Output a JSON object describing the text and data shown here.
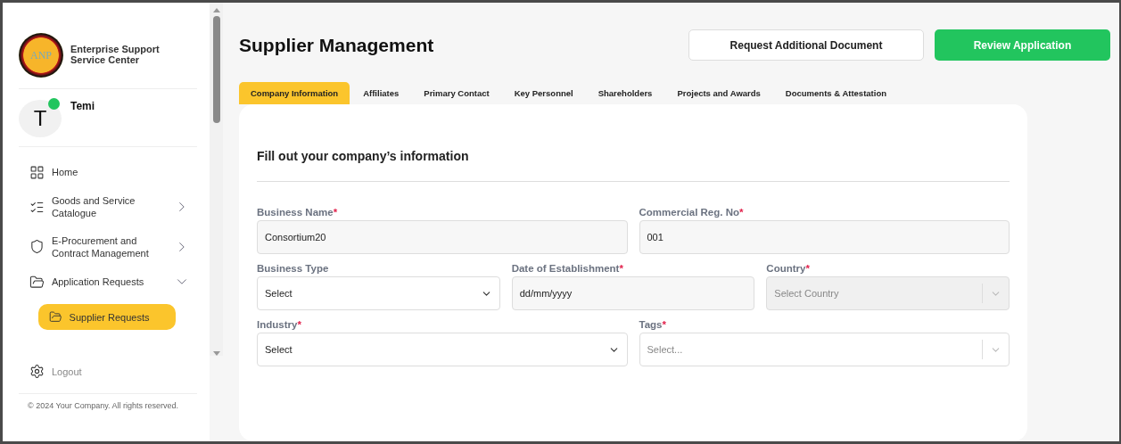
{
  "sidebar": {
    "logo_text": "ANP",
    "org_name": "Enterprise Support Service Center",
    "user": {
      "initial": "T",
      "name": "Temi",
      "online": true
    },
    "nav": [
      {
        "label": "Home",
        "kind": "link",
        "selected": false
      },
      {
        "label": "Goods and Service Catalogue",
        "kind": "menu",
        "expanded": false,
        "selected": false
      },
      {
        "label": "E-Procurement and Contract Management",
        "kind": "menu",
        "expanded": false,
        "selected": false
      },
      {
        "label": "Application Requests",
        "kind": "menu",
        "expanded": true,
        "selected": false,
        "children": [
          {
            "label": "Supplier Requests",
            "selected": true
          }
        ]
      }
    ],
    "logout": "Logout",
    "footer": "© 2024 Your Company. All rights reserved."
  },
  "header": {
    "title": "Supplier Management",
    "buttons": [
      {
        "label": "Request Additional Document",
        "kind": "secondary"
      },
      {
        "label": "Review Application",
        "kind": "primary"
      }
    ]
  },
  "tabs": [
    {
      "label": "Company Information",
      "selected": true
    },
    {
      "label": "Affiliates",
      "selected": false
    },
    {
      "label": "Primary Contact",
      "selected": false
    },
    {
      "label": "Key Personnel",
      "selected": false
    },
    {
      "label": "Shareholders",
      "selected": false
    },
    {
      "label": "Projects and Awards",
      "selected": false
    },
    {
      "label": "Documents & Attestation",
      "selected": false
    }
  ],
  "form": {
    "heading": "Fill out your company’s information",
    "rows": [
      [
        {
          "label": "Business Name",
          "mark": "*",
          "kind": "input",
          "value": "Consortium20",
          "disabled": false
        },
        {
          "label": "Commercial Reg. No",
          "mark": "*",
          "kind": "input",
          "value": "001",
          "disabled": false
        }
      ],
      [
        {
          "label": "Business Type",
          "kind": "select",
          "placeholder": "Select",
          "disabled": false
        },
        {
          "label": "Date of Establishment",
          "mark": "*",
          "kind": "input",
          "value": "dd/mm/yyyy",
          "disabled": false
        },
        {
          "label": "Country",
          "mark": "*",
          "kind": "combo",
          "placeholder": "Select Country",
          "disabled": true
        }
      ],
      [
        {
          "label": "Industry",
          "mark": "*",
          "kind": "select",
          "placeholder": "Select",
          "disabled": false
        },
        {
          "label": "Tags",
          "mark": "*",
          "kind": "combo",
          "placeholder": "Select...",
          "disabled": false
        }
      ]
    ]
  }
}
